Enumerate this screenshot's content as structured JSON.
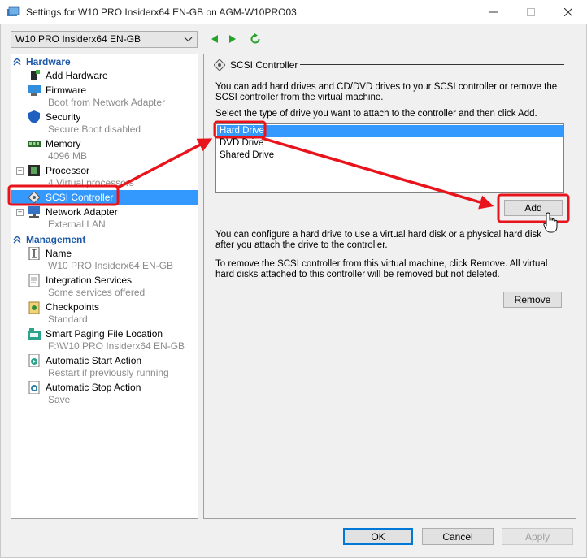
{
  "window": {
    "title": "Settings for W10 PRO Insiderx64 EN-GB on AGM-W10PRO03",
    "accent": "#3399ff",
    "annotation_color": "#e8131b"
  },
  "toolbar": {
    "vm_name": "W10 PRO Insiderx64 EN-GB"
  },
  "sidebar": {
    "hardware_label": "Hardware",
    "management_label": "Management",
    "hardware": [
      {
        "label": "Add Hardware",
        "sub": "",
        "icon": "add-hardware-icon"
      },
      {
        "label": "Firmware",
        "sub": "Boot from Network Adapter",
        "icon": "firmware-icon"
      },
      {
        "label": "Security",
        "sub": "Secure Boot disabled",
        "icon": "shield-icon"
      },
      {
        "label": "Memory",
        "sub": "4096 MB",
        "icon": "memory-icon"
      },
      {
        "label": "Processor",
        "sub": "4 Virtual processors",
        "icon": "processor-icon"
      },
      {
        "label": "SCSI Controller",
        "sub": "",
        "icon": "scsi-icon"
      },
      {
        "label": "Network Adapter",
        "sub": "External LAN",
        "icon": "network-icon"
      }
    ],
    "management": [
      {
        "label": "Name",
        "sub": "W10 PRO Insiderx64 EN-GB",
        "icon": "name-icon"
      },
      {
        "label": "Integration Services",
        "sub": "Some services offered",
        "icon": "integration-icon"
      },
      {
        "label": "Checkpoints",
        "sub": "Standard",
        "icon": "checkpoint-icon"
      },
      {
        "label": "Smart Paging File Location",
        "sub": "F:\\W10 PRO Insiderx64 EN-GB",
        "icon": "paging-icon"
      },
      {
        "label": "Automatic Start Action",
        "sub": "Restart if previously running",
        "icon": "start-action-icon"
      },
      {
        "label": "Automatic Stop Action",
        "sub": "Save",
        "icon": "stop-action-icon"
      }
    ]
  },
  "panel": {
    "title": "SCSI Controller",
    "intro": "You can add hard drives and CD/DVD drives to your SCSI controller or remove the SCSI controller from the virtual machine.",
    "select_prompt": "Select the type of drive you want to attach to the controller and then click Add.",
    "drive_types": [
      "Hard Drive",
      "DVD Drive",
      "Shared Drive"
    ],
    "add_label": "Add",
    "configure_text": "You can configure a hard drive to use a virtual hard disk or a physical hard disk after you attach the drive to the controller.",
    "remove_text": "To remove the SCSI controller from this virtual machine, click Remove. All virtual hard disks attached to this controller will be removed but not deleted.",
    "remove_label": "Remove"
  },
  "footer": {
    "ok_label": "OK",
    "cancel_label": "Cancel",
    "apply_label": "Apply"
  }
}
